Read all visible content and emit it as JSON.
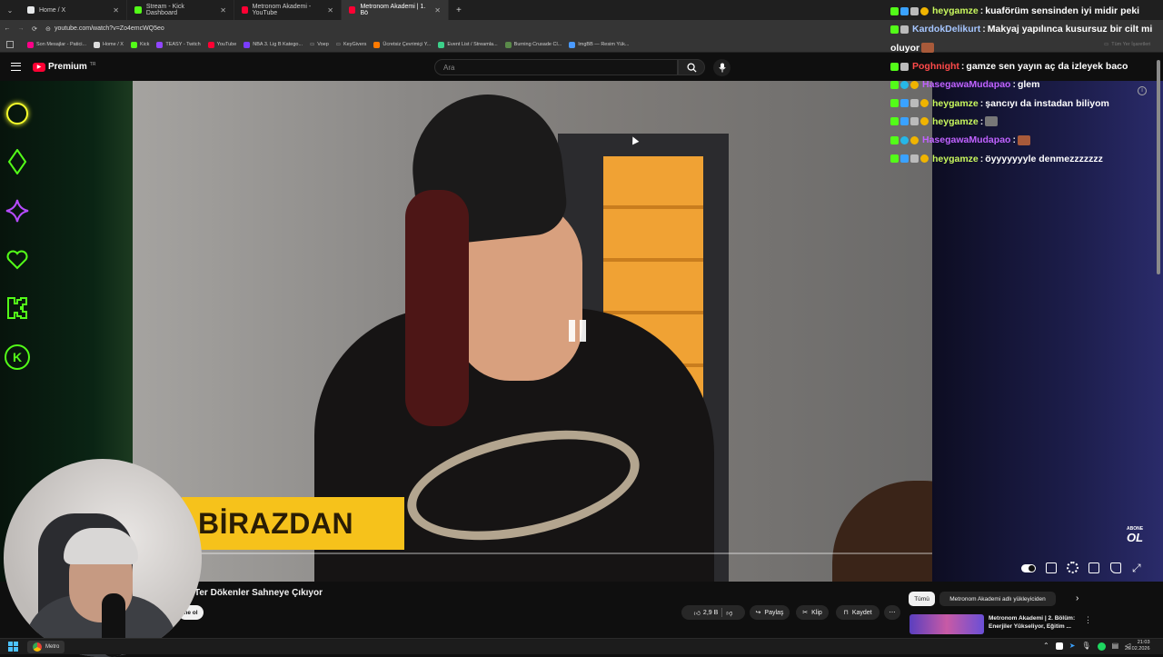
{
  "browser": {
    "tabs": [
      {
        "label": "Home / X",
        "color": "#e7e9ea"
      },
      {
        "label": "Stream - Kick Dashboard",
        "color": "#53fc18"
      },
      {
        "label": "Metronom Akademi - YouTube",
        "color": "#ff0033"
      },
      {
        "label": "Metronom Akademi | 1. Bö",
        "color": "#ff0033",
        "active": true
      }
    ],
    "new_tab": "+",
    "url": "youtube.com/watch?v=Zo4emcWQ5eo",
    "bookmarks": [
      {
        "label": "Son Mesajlar - Patici...",
        "color": "#f08"
      },
      {
        "label": "Home / X",
        "color": "#ddd"
      },
      {
        "label": "Kick",
        "color": "#53fc18"
      },
      {
        "label": "TEASY - Twitch",
        "color": "#9146ff"
      },
      {
        "label": "YouTube",
        "color": "#ff0033"
      },
      {
        "label": "NBA 3. Lig B Katego...",
        "color": "#7a3cff"
      },
      {
        "label": "Voep",
        "color": "#aaa"
      },
      {
        "label": "KeyGivers",
        "color": "#aaa"
      },
      {
        "label": "Ücretsiz Çevrimiçi Y...",
        "color": "#ff7a00"
      },
      {
        "label": "Event List / Streamla...",
        "color": "#3cd08a"
      },
      {
        "label": "Burning Crusade Cl...",
        "color": "#5a8a4a"
      },
      {
        "label": "ImgBB — Resim Yük...",
        "color": "#4a9aff"
      }
    ],
    "other_bookmarks": "Tüm Yer İşaretleri"
  },
  "youtube": {
    "logo_text": "Premium",
    "logo_sup": "TR",
    "search_placeholder": "Ara",
    "overlay_caption": "BİRAZDAN",
    "subscribe_badge": [
      "ABONE",
      "OL"
    ],
    "video_title": "Ter Dökenler Sahneye Çıkıyor",
    "subscribe_partial": "ne ol",
    "likes": "2,9 B",
    "share": "Paylaş",
    "clip": "Klip",
    "save": "Kaydet",
    "chips": [
      "Tümü",
      "Metronom Akademi adlı yükleyiciden"
    ],
    "rec_title_1": "Metronom Akademi | 2. Bölüm:",
    "rec_title_2": "Enerjiler Yükseliyor, Eğitim ..."
  },
  "chat": [
    {
      "user": "heygamze",
      "user_color": "#c9f85e",
      "text": "kuaförüm sensinden iyi midir peki"
    },
    {
      "user": "KardokDelikurt",
      "user_color": "#a6c6ff",
      "text": "Makyaj yapılınca kusursuz bir cilt mi"
    },
    {
      "user": "",
      "user_color": "#ffffff",
      "text": "oluyor",
      "emote": true
    },
    {
      "user": "Poghnight",
      "user_color": "#ff4a4a",
      "text": "gamze sen yayın aç da izleyek baco"
    },
    {
      "user": "HasegawaMudapao",
      "user_color": "#c062ff",
      "text": "glem"
    },
    {
      "user": "heygamze",
      "user_color": "#c9f85e",
      "text": "şancıyı da instadan biliyom"
    },
    {
      "user": "heygamze",
      "user_color": "#c9f85e",
      "text": "",
      "emote": true
    },
    {
      "user": "HasegawaMudapao",
      "user_color": "#c062ff",
      "text": "",
      "emote": true
    },
    {
      "user": "heygamze",
      "user_color": "#c9f85e",
      "text": "öyyyyyyyle denmezzzzzzz"
    }
  ],
  "taskbar": {
    "app_label": "Metro",
    "time": "21:03",
    "date": "26.02.2026"
  },
  "colors": {
    "kick_green": "#53fc18",
    "yt_red": "#ff0033",
    "caption_yellow": "#f6c21b"
  }
}
